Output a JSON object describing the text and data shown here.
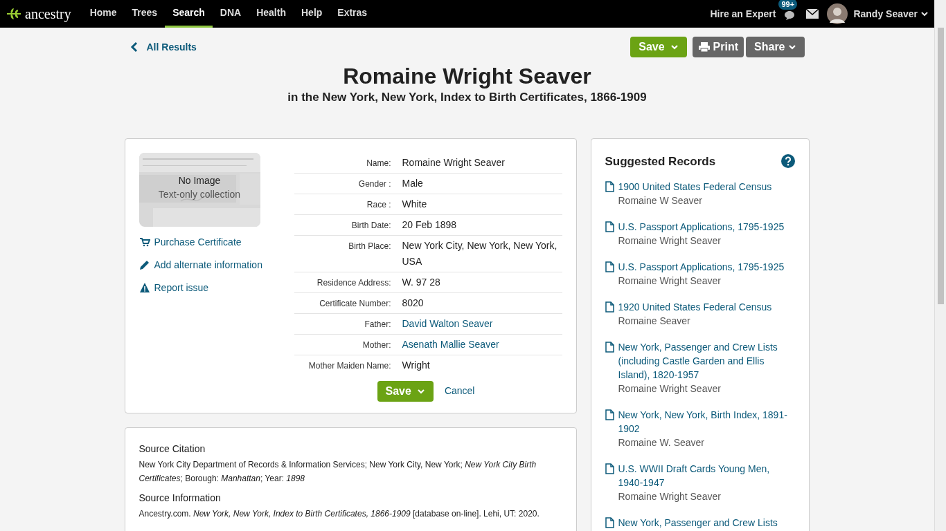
{
  "header": {
    "logo": "ancestry",
    "nav": [
      {
        "label": "Home",
        "selected": false
      },
      {
        "label": "Trees",
        "selected": false
      },
      {
        "label": "Search",
        "selected": true
      },
      {
        "label": "DNA",
        "selected": false
      },
      {
        "label": "Health",
        "selected": false
      },
      {
        "label": "Help",
        "selected": false
      },
      {
        "label": "Extras",
        "selected": false
      }
    ],
    "hire": "Hire an Expert",
    "badge": "99+",
    "user": "Randy Seaver"
  },
  "back": "All Results",
  "actions": {
    "save": "Save",
    "print": "Print",
    "share": "Share"
  },
  "title": "Romaine Wright Seaver",
  "subtitle": "in the New York, New York, Index to Birth Certificates, 1866-1909",
  "image": {
    "kind": "picture",
    "line1": "No Image",
    "line2": "Text-only collection"
  },
  "side_links": [
    {
      "kind": "cart",
      "label": "Purchase Certificate"
    },
    {
      "kind": "pencil",
      "label": "Add alternate information"
    },
    {
      "kind": "warning",
      "label": "Report issue"
    }
  ],
  "fields": [
    {
      "label": "Name:",
      "value": "Romaine Wright Seaver",
      "link": false
    },
    {
      "label": "Gender :",
      "value": "Male",
      "link": false
    },
    {
      "label": "Race :",
      "value": "White",
      "link": false
    },
    {
      "label": "Birth Date:",
      "value": "20 Feb 1898",
      "link": false
    },
    {
      "label": "Birth Place:",
      "value": "New York City, New York, New York, USA",
      "link": false
    },
    {
      "label": "Residence Address:",
      "value": "W. 97 28",
      "link": false
    },
    {
      "label": "Certificate Number:",
      "value": "8020",
      "link": false
    },
    {
      "label": "Father:",
      "value": "David Walton Seaver",
      "link": true
    },
    {
      "label": "Mother:",
      "value": "Asenath Mallie Seaver",
      "link": true
    },
    {
      "label": "Mother Maiden Name:",
      "value": "Wright",
      "link": false
    }
  ],
  "form_buttons": {
    "save": "Save",
    "cancel": "Cancel"
  },
  "source": [
    {
      "heading": "Source Citation",
      "text": "New York City Department of Records & Information Services; New York City, New York; *New York City Birth Certificates*; Borough: *Manhattan*; Year: *1898*"
    },
    {
      "heading": "Source Information",
      "text": "Ancestry.com. *New York, New York, Index to Birth Certificates, 1866-1909* [database on-line]. Lehi, UT: 2020."
    }
  ],
  "suggested": {
    "title": "Suggested Records",
    "records": [
      {
        "title": "1900 United States Federal Census",
        "name": "Romaine W Seaver"
      },
      {
        "title": "U.S. Passport Applications, 1795-1925",
        "name": "Romaine Wright Seaver"
      },
      {
        "title": "U.S. Passport Applications, 1795-1925",
        "name": "Romaine Wright Seaver"
      },
      {
        "title": "1920 United States Federal Census",
        "name": "Romaine Seaver"
      },
      {
        "title": "New York, Passenger and Crew Lists (including Castle Garden and Ellis Island), 1820-1957",
        "name": "Romaine Wright Seaver"
      },
      {
        "title": "New York, New York, Birth Index, 1891-1902",
        "name": "Romaine W. Seaver"
      },
      {
        "title": "U.S. WWII Draft Cards Young Men, 1940-1947",
        "name": "Romaine Wright Seaver"
      },
      {
        "title": "New York, Passenger and Crew Lists"
      }
    ]
  }
}
